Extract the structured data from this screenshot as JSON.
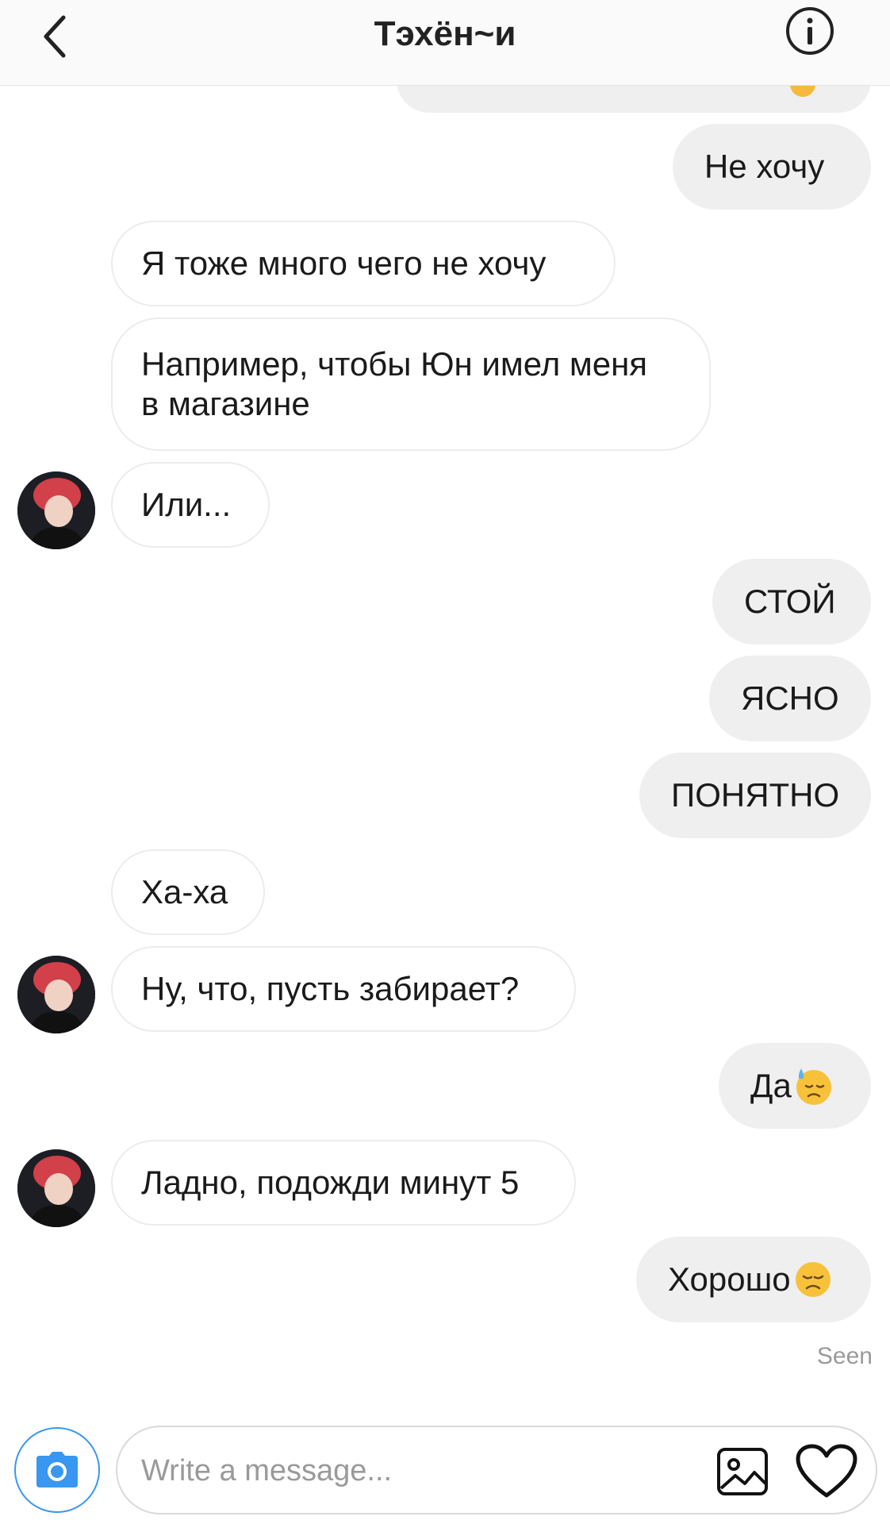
{
  "header": {
    "title": "Тэхён~и"
  },
  "messages": [
    {
      "dir": "out",
      "text": "Не хочу"
    },
    {
      "dir": "in",
      "text": "Я тоже много чего не хочу"
    },
    {
      "dir": "in",
      "lines": [
        "Например, чтобы Юн имел меня",
        "в магазине"
      ]
    },
    {
      "dir": "in",
      "text": "Или..."
    },
    {
      "dir": "out",
      "text": "СТОЙ"
    },
    {
      "dir": "out",
      "text": "ЯСНО"
    },
    {
      "dir": "out",
      "text": "ПОНЯТНО"
    },
    {
      "dir": "in",
      "text": "Ха-ха"
    },
    {
      "dir": "in",
      "text": "Ну, что, пусть забирает?"
    },
    {
      "dir": "out",
      "text": "Да",
      "emoji": "downcast-face-with-sweat-emoji"
    },
    {
      "dir": "in",
      "text": "Ладно, подожди минут 5"
    },
    {
      "dir": "out",
      "text": "Хорошо",
      "emoji": "disappointed-face-emoji"
    }
  ],
  "status": {
    "seen": "Seen"
  },
  "composer": {
    "placeholder": "Write a message..."
  },
  "colors": {
    "accent": "#3897f0",
    "outgoing_bubble": "#efefef",
    "incoming_border": "#ececec"
  },
  "icons": {
    "back": "chevron-left-icon",
    "info": "info-icon",
    "camera": "camera-icon",
    "gallery": "image-icon",
    "like": "heart-icon"
  }
}
